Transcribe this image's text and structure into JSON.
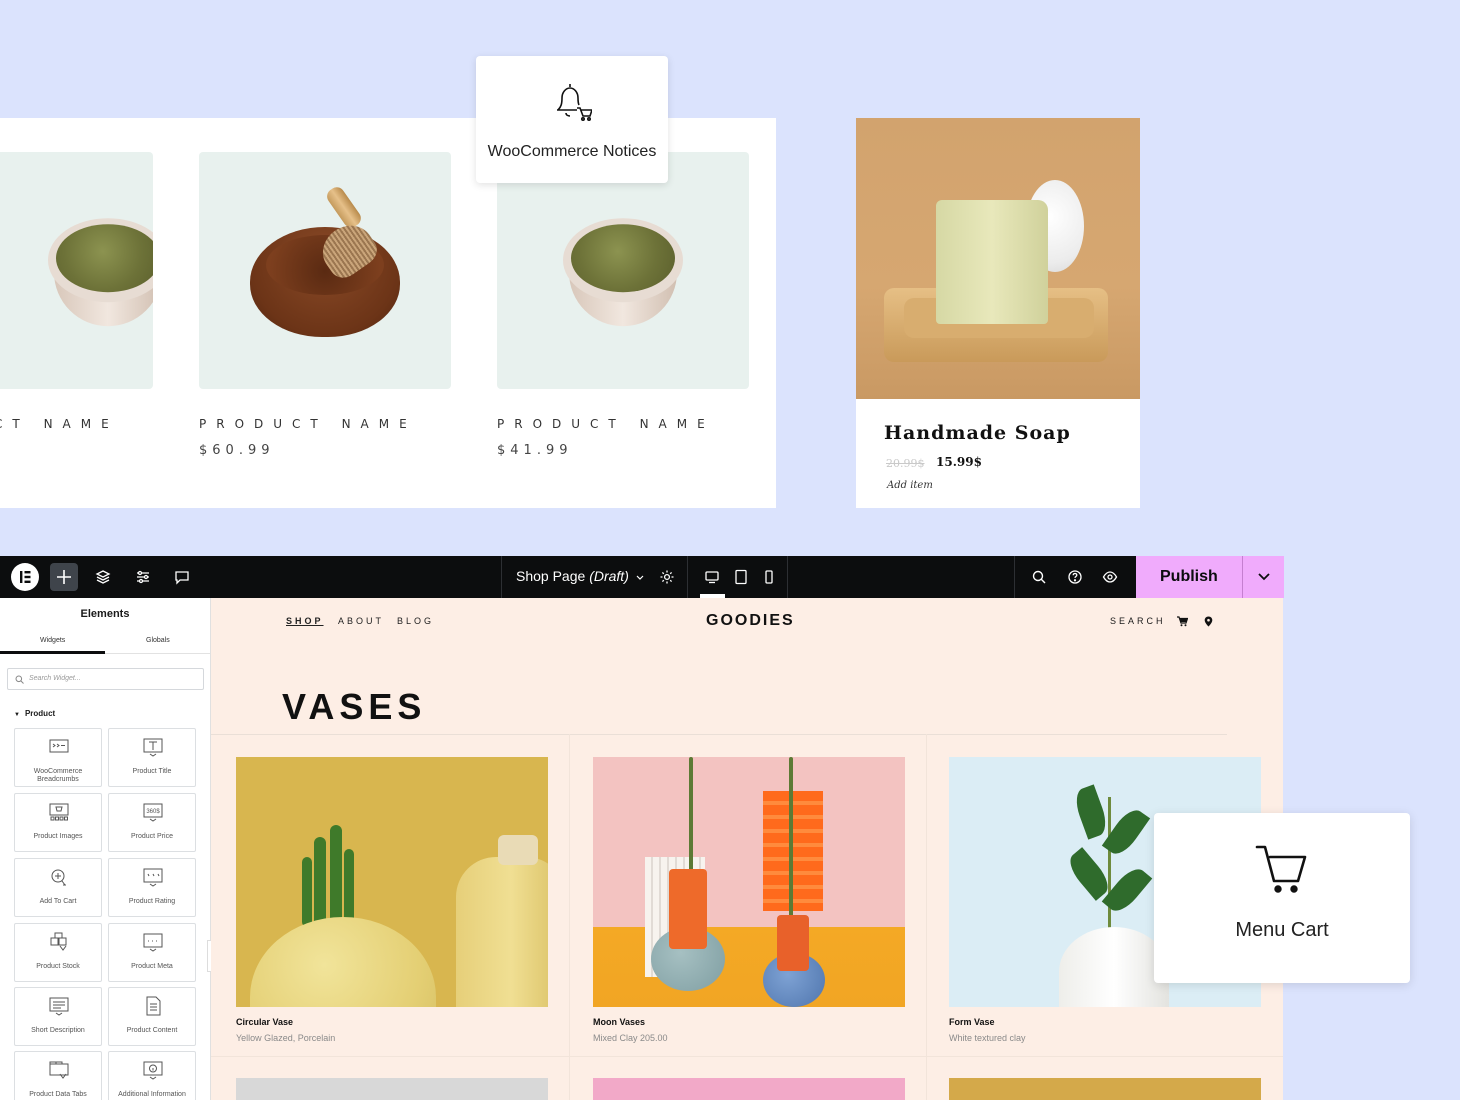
{
  "product_strip": {
    "cards": [
      {
        "name": "PRODUCT NAME",
        "price": ""
      },
      {
        "name": "PRODUCT NAME",
        "price": "$60.99"
      },
      {
        "name": "PRODUCT NAME",
        "price": "$41.99"
      }
    ]
  },
  "notice_widget": {
    "label": "WooCommerce Notices",
    "icon": "bell-cart-icon"
  },
  "soap_card": {
    "title": "Handmade Soap",
    "old_price": "20.99$",
    "new_price": "15.99$",
    "add_label": "Add item"
  },
  "topbar": {
    "doc_title": "Shop Page",
    "doc_status": "(Draft)",
    "publish_label": "Publish"
  },
  "panel": {
    "title": "Elements",
    "tabs": [
      "Widgets",
      "Globals"
    ],
    "search_placeholder": "Search Widget...",
    "category": "Product",
    "widgets": [
      {
        "label": "WooCommerce Breadcrumbs",
        "icon": "breadcrumbs-icon"
      },
      {
        "label": "Product Title",
        "icon": "product-title-icon"
      },
      {
        "label": "Product Images",
        "icon": "product-images-icon"
      },
      {
        "label": "Product Price",
        "icon": "product-price-icon"
      },
      {
        "label": "Add To Cart",
        "icon": "add-to-cart-icon"
      },
      {
        "label": "Product Rating",
        "icon": "product-rating-icon"
      },
      {
        "label": "Product Stock",
        "icon": "product-stock-icon"
      },
      {
        "label": "Product Meta",
        "icon": "product-meta-icon"
      },
      {
        "label": "Short Description",
        "icon": "short-description-icon"
      },
      {
        "label": "Product Content",
        "icon": "product-content-icon"
      },
      {
        "label": "Product Data Tabs",
        "icon": "product-data-tabs-icon"
      },
      {
        "label": "Additional Information",
        "icon": "additional-information-icon"
      }
    ],
    "price_icon_text": "360$"
  },
  "site": {
    "nav": [
      "SHOP",
      "ABOUT",
      "BLOG"
    ],
    "brand": "GOODIES",
    "search_label": "SEARCH",
    "heading": "VASES",
    "products": [
      {
        "name": "Circular Vase",
        "desc": "Yellow Glazed, Porcelain"
      },
      {
        "name": "Moon Vases",
        "desc": "Mixed Clay  205.00"
      },
      {
        "name": "Form Vase",
        "desc": "White textured clay"
      }
    ]
  },
  "menu_cart_widget": {
    "label": "Menu Cart",
    "icon": "cart-icon"
  },
  "colors": {
    "background": "#dbe3fd",
    "topbar": "#0c0d0e",
    "publish": "#f0abfc",
    "canvas": "#fdeee5"
  }
}
